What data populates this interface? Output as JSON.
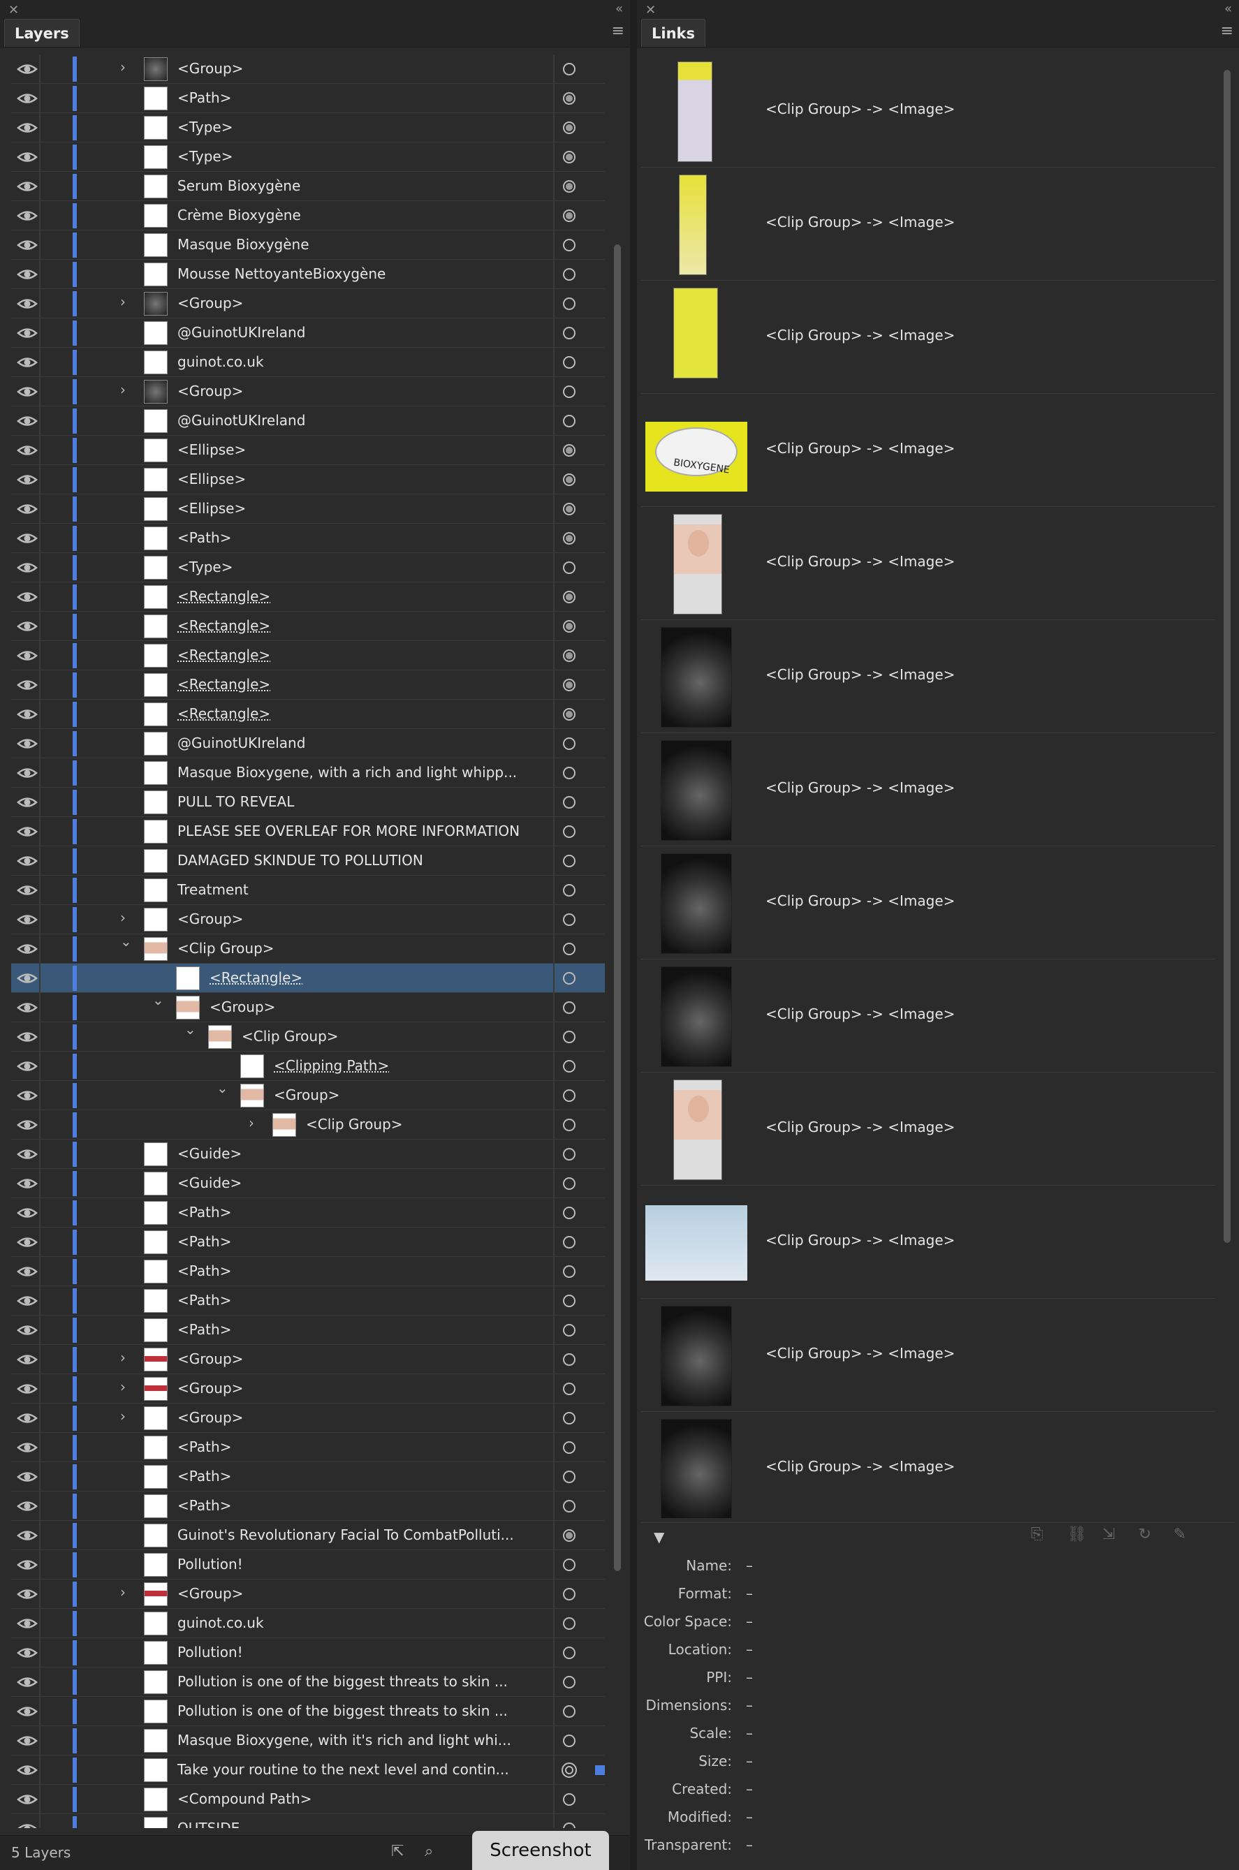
{
  "layers_panel": {
    "title": "Layers",
    "footer_count": "5 Layers",
    "rows": [
      {
        "name": "<Group>",
        "level": 0,
        "twisty": "right",
        "target": "empty",
        "thumb": "dark"
      },
      {
        "name": "<Path>",
        "level": 0,
        "twisty": "",
        "target": "filled",
        "thumb": "white"
      },
      {
        "name": "<Type>",
        "level": 0,
        "twisty": "",
        "target": "filled",
        "thumb": "white"
      },
      {
        "name": "<Type>",
        "level": 0,
        "twisty": "",
        "target": "filled",
        "thumb": "white"
      },
      {
        "name": "Serum Bioxygène",
        "level": 0,
        "twisty": "",
        "target": "filled",
        "thumb": "white"
      },
      {
        "name": "Crème Bioxygène",
        "level": 0,
        "twisty": "",
        "target": "filled",
        "thumb": "white"
      },
      {
        "name": "Masque Bioxygène",
        "level": 0,
        "twisty": "",
        "target": "empty",
        "thumb": "white"
      },
      {
        "name": "Mousse NettoyanteBioxygène",
        "level": 0,
        "twisty": "",
        "target": "empty",
        "thumb": "white"
      },
      {
        "name": "<Group>",
        "level": 0,
        "twisty": "right",
        "target": "empty",
        "thumb": "dark"
      },
      {
        "name": "@GuinotUKIreland",
        "level": 0,
        "twisty": "",
        "target": "empty",
        "thumb": "white"
      },
      {
        "name": "guinot.co.uk",
        "level": 0,
        "twisty": "",
        "target": "empty",
        "thumb": "white"
      },
      {
        "name": "<Group>",
        "level": 0,
        "twisty": "right",
        "target": "empty",
        "thumb": "dark"
      },
      {
        "name": "@GuinotUKIreland",
        "level": 0,
        "twisty": "",
        "target": "empty",
        "thumb": "white"
      },
      {
        "name": "<Ellipse>",
        "level": 0,
        "twisty": "",
        "target": "filled",
        "thumb": "white"
      },
      {
        "name": "<Ellipse>",
        "level": 0,
        "twisty": "",
        "target": "filled",
        "thumb": "white"
      },
      {
        "name": "<Ellipse>",
        "level": 0,
        "twisty": "",
        "target": "filled",
        "thumb": "white"
      },
      {
        "name": "<Path>",
        "level": 0,
        "twisty": "",
        "target": "filled",
        "thumb": "white"
      },
      {
        "name": "<Type>",
        "level": 0,
        "twisty": "",
        "target": "empty",
        "thumb": "white"
      },
      {
        "name": "<Rectangle>",
        "level": 0,
        "twisty": "",
        "target": "filled",
        "thumb": "white",
        "underline": true
      },
      {
        "name": "<Rectangle>",
        "level": 0,
        "twisty": "",
        "target": "filled",
        "thumb": "white",
        "underline": true
      },
      {
        "name": "<Rectangle>",
        "level": 0,
        "twisty": "",
        "target": "filled",
        "thumb": "white",
        "underline": true
      },
      {
        "name": "<Rectangle>",
        "level": 0,
        "twisty": "",
        "target": "filled",
        "thumb": "white",
        "underline": true
      },
      {
        "name": "<Rectangle>",
        "level": 0,
        "twisty": "",
        "target": "filled",
        "thumb": "white",
        "underline": true
      },
      {
        "name": "@GuinotUKIreland",
        "level": 0,
        "twisty": "",
        "target": "empty",
        "thumb": "white"
      },
      {
        "name": "Masque Bioxygene, with a rich and light whipp...",
        "level": 0,
        "twisty": "",
        "target": "empty",
        "thumb": "white"
      },
      {
        "name": "PULL TO REVEAL",
        "level": 0,
        "twisty": "",
        "target": "empty",
        "thumb": "white"
      },
      {
        "name": "PLEASE SEE OVERLEAF FOR MORE INFORMATION",
        "level": 0,
        "twisty": "",
        "target": "empty",
        "thumb": "white"
      },
      {
        "name": "DAMAGED SKINDUE TO POLLUTION",
        "level": 0,
        "twisty": "",
        "target": "empty",
        "thumb": "white"
      },
      {
        "name": "Treatment",
        "level": 0,
        "twisty": "",
        "target": "empty",
        "thumb": "white"
      },
      {
        "name": "<Group>",
        "level": 0,
        "twisty": "right",
        "target": "empty",
        "thumb": "white"
      },
      {
        "name": "<Clip Group>",
        "level": 0,
        "twisty": "down",
        "target": "empty",
        "thumb": "face"
      },
      {
        "name": "<Rectangle>",
        "level": 1,
        "twisty": "",
        "target": "empty",
        "thumb": "white",
        "underline": true,
        "selected": true
      },
      {
        "name": "<Group>",
        "level": 1,
        "twisty": "down",
        "target": "empty",
        "thumb": "face"
      },
      {
        "name": "<Clip Group>",
        "level": 2,
        "twisty": "down",
        "target": "empty",
        "thumb": "face"
      },
      {
        "name": "<Clipping Path>",
        "level": 3,
        "twisty": "",
        "target": "empty",
        "thumb": "white",
        "underline": true
      },
      {
        "name": "<Group>",
        "level": 3,
        "twisty": "down",
        "target": "empty",
        "thumb": "face"
      },
      {
        "name": "<Clip Group>",
        "level": 4,
        "twisty": "right",
        "target": "empty",
        "thumb": "face"
      },
      {
        "name": "<Guide>",
        "level": 0,
        "twisty": "",
        "target": "empty",
        "thumb": "white"
      },
      {
        "name": "<Guide>",
        "level": 0,
        "twisty": "",
        "target": "empty",
        "thumb": "white"
      },
      {
        "name": "<Path>",
        "level": 0,
        "twisty": "",
        "target": "empty",
        "thumb": "white"
      },
      {
        "name": "<Path>",
        "level": 0,
        "twisty": "",
        "target": "empty",
        "thumb": "white"
      },
      {
        "name": "<Path>",
        "level": 0,
        "twisty": "",
        "target": "empty",
        "thumb": "white"
      },
      {
        "name": "<Path>",
        "level": 0,
        "twisty": "",
        "target": "empty",
        "thumb": "white"
      },
      {
        "name": "<Path>",
        "level": 0,
        "twisty": "",
        "target": "empty",
        "thumb": "white"
      },
      {
        "name": "<Group>",
        "level": 0,
        "twisty": "right",
        "target": "empty",
        "thumb": "logo"
      },
      {
        "name": "<Group>",
        "level": 0,
        "twisty": "right",
        "target": "empty",
        "thumb": "logo"
      },
      {
        "name": "<Group>",
        "level": 0,
        "twisty": "right",
        "target": "empty",
        "thumb": "white"
      },
      {
        "name": "<Path>",
        "level": 0,
        "twisty": "",
        "target": "empty",
        "thumb": "white"
      },
      {
        "name": "<Path>",
        "level": 0,
        "twisty": "",
        "target": "empty",
        "thumb": "white"
      },
      {
        "name": "<Path>",
        "level": 0,
        "twisty": "",
        "target": "empty",
        "thumb": "white"
      },
      {
        "name": "Guinot's Revolutionary Facial To CombatPolluti...",
        "level": 0,
        "twisty": "",
        "target": "filled",
        "thumb": "white"
      },
      {
        "name": "Pollution!",
        "level": 0,
        "twisty": "",
        "target": "empty",
        "thumb": "white"
      },
      {
        "name": "<Group>",
        "level": 0,
        "twisty": "right",
        "target": "empty",
        "thumb": "logo"
      },
      {
        "name": "guinot.co.uk",
        "level": 0,
        "twisty": "",
        "target": "empty",
        "thumb": "white"
      },
      {
        "name": "Pollution!",
        "level": 0,
        "twisty": "",
        "target": "empty",
        "thumb": "white"
      },
      {
        "name": "Pollution is one of the biggest threats to skin ...",
        "level": 0,
        "twisty": "",
        "target": "empty",
        "thumb": "white"
      },
      {
        "name": "Pollution is one of the biggest threats to skin ...",
        "level": 0,
        "twisty": "",
        "target": "empty",
        "thumb": "white"
      },
      {
        "name": "Masque Bioxygene, with it's rich and light whi...",
        "level": 0,
        "twisty": "",
        "target": "empty",
        "thumb": "white"
      },
      {
        "name": "Take your routine to the next level and contin...",
        "level": 0,
        "twisty": "",
        "target": "double",
        "thumb": "white",
        "selsq": true
      },
      {
        "name": "<Compound Path>",
        "level": 0,
        "twisty": "",
        "target": "empty",
        "thumb": "white"
      },
      {
        "name": "OUTSIDE",
        "level": 0,
        "twisty": "",
        "target": "empty",
        "thumb": "white"
      }
    ]
  },
  "links_panel": {
    "title": "Links",
    "items": [
      {
        "name": "<Clip Group> -> <Image>",
        "thumb": "prod1"
      },
      {
        "name": "<Clip Group> -> <Image>",
        "thumb": "prod2"
      },
      {
        "name": "<Clip Group> -> <Image>",
        "thumb": "prod3"
      },
      {
        "name": "<Clip Group> -> <Image>",
        "thumb": "jar"
      },
      {
        "name": "<Clip Group> -> <Image>",
        "thumb": "face"
      },
      {
        "name": "<Clip Group> -> <Image>",
        "thumb": "smoke"
      },
      {
        "name": "<Clip Group> -> <Image>",
        "thumb": "smoke"
      },
      {
        "name": "<Clip Group> -> <Image>",
        "thumb": "smoke"
      },
      {
        "name": "<Clip Group> -> <Image>",
        "thumb": "smoke"
      },
      {
        "name": "<Clip Group> -> <Image>",
        "thumb": "face"
      },
      {
        "name": "<Clip Group> -> <Image>",
        "thumb": "sky"
      },
      {
        "name": "<Clip Group> -> <Image>",
        "thumb": "smoke"
      },
      {
        "name": "<Clip Group> -> <Image>",
        "thumb": "smoke"
      }
    ],
    "jar_label": "BIOXYGENE",
    "info": [
      {
        "label": "Name:",
        "value": "–"
      },
      {
        "label": "Format:",
        "value": "–"
      },
      {
        "label": "Color Space:",
        "value": "–"
      },
      {
        "label": "Location:",
        "value": "–"
      },
      {
        "label": "PPI:",
        "value": "–"
      },
      {
        "label": "Dimensions:",
        "value": "–"
      },
      {
        "label": "Scale:",
        "value": "–"
      },
      {
        "label": "Size:",
        "value": "–"
      },
      {
        "label": "Created:",
        "value": "–"
      },
      {
        "label": "Modified:",
        "value": "–"
      },
      {
        "label": "Transparent:",
        "value": "–"
      }
    ]
  },
  "overlay": {
    "screenshot_label": "Screenshot"
  },
  "colors": {
    "layer_color": "#4e7fe0",
    "selection": "#3a5878",
    "panel_bg": "#2b2b2b"
  }
}
